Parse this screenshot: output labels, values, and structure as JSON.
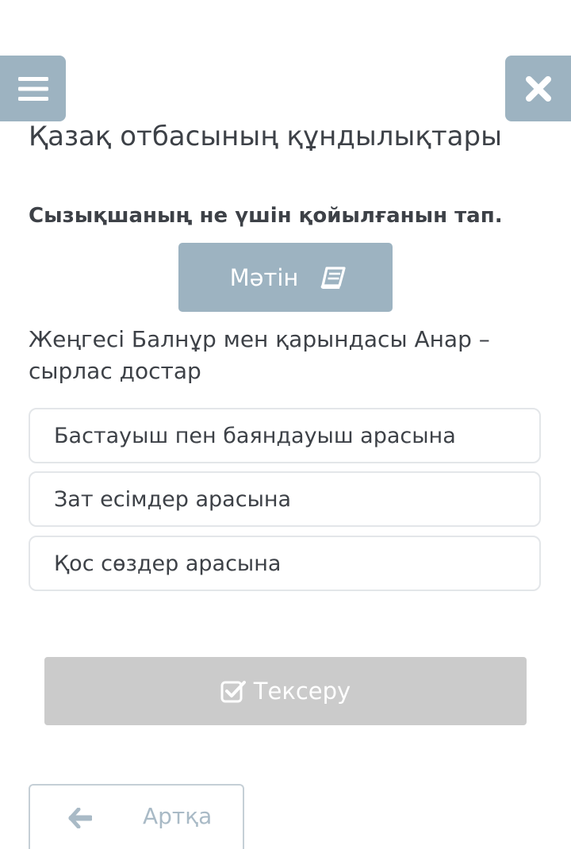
{
  "header": {
    "menu_icon": "hamburger-menu-icon",
    "close_icon": "close-icon"
  },
  "title": "Қазақ отбасының құндылықтары",
  "instruction": "Сызықшаның не үшін қойылғанын тап.",
  "text_button": {
    "label": "Мәтін",
    "icon": "book-icon"
  },
  "sentence": "Жеңгесі Балнұр мен қарындасы Анар – сырлас достар",
  "options": [
    {
      "label": "Бастауыш пен баяндауыш арасына"
    },
    {
      "label": "Зат есімдер арасына"
    },
    {
      "label": "Қос сөздер арасына"
    }
  ],
  "check_button": {
    "label": "Тексеру",
    "icon": "check-square-icon"
  },
  "back_button": {
    "label": "Артқа",
    "icon": "arrow-left-icon"
  },
  "colors": {
    "accent": "#9db3c1",
    "disabled": "#cbcbcb",
    "text": "#3d4147",
    "border": "#e3e6e9"
  }
}
